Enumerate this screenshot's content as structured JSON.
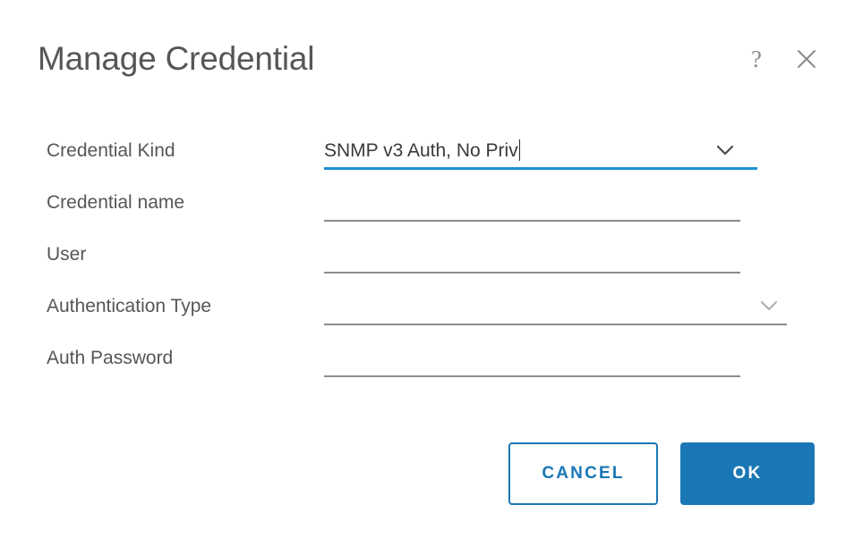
{
  "dialog": {
    "title": "Manage Credential",
    "help_icon": "question-mark-icon",
    "close_icon": "close-icon",
    "accent_color": "#1a77b5",
    "focus_underline_color": "#1b91d5",
    "label_color": "#565656",
    "underline_color": "#8c8c8c",
    "background": "#ffffff"
  },
  "form": {
    "fields": [
      {
        "label": "Credential Kind",
        "type": "select",
        "value": "SNMP v3 Auth, No Priv",
        "placeholder": "",
        "focused": true,
        "chevron_icon": "chevron-down-icon"
      },
      {
        "label": "Credential name",
        "type": "text",
        "value": "",
        "placeholder": "",
        "focused": false
      },
      {
        "label": "User",
        "type": "text",
        "value": "",
        "placeholder": "",
        "focused": false
      },
      {
        "label": "Authentication Type",
        "type": "select",
        "value": "",
        "placeholder": "",
        "focused": false,
        "chevron_icon": "chevron-down-icon"
      },
      {
        "label": "Auth Password",
        "type": "password",
        "value": "",
        "placeholder": "",
        "focused": false
      }
    ]
  },
  "footer": {
    "cancel_label": "CANCEL",
    "ok_label": "OK"
  }
}
